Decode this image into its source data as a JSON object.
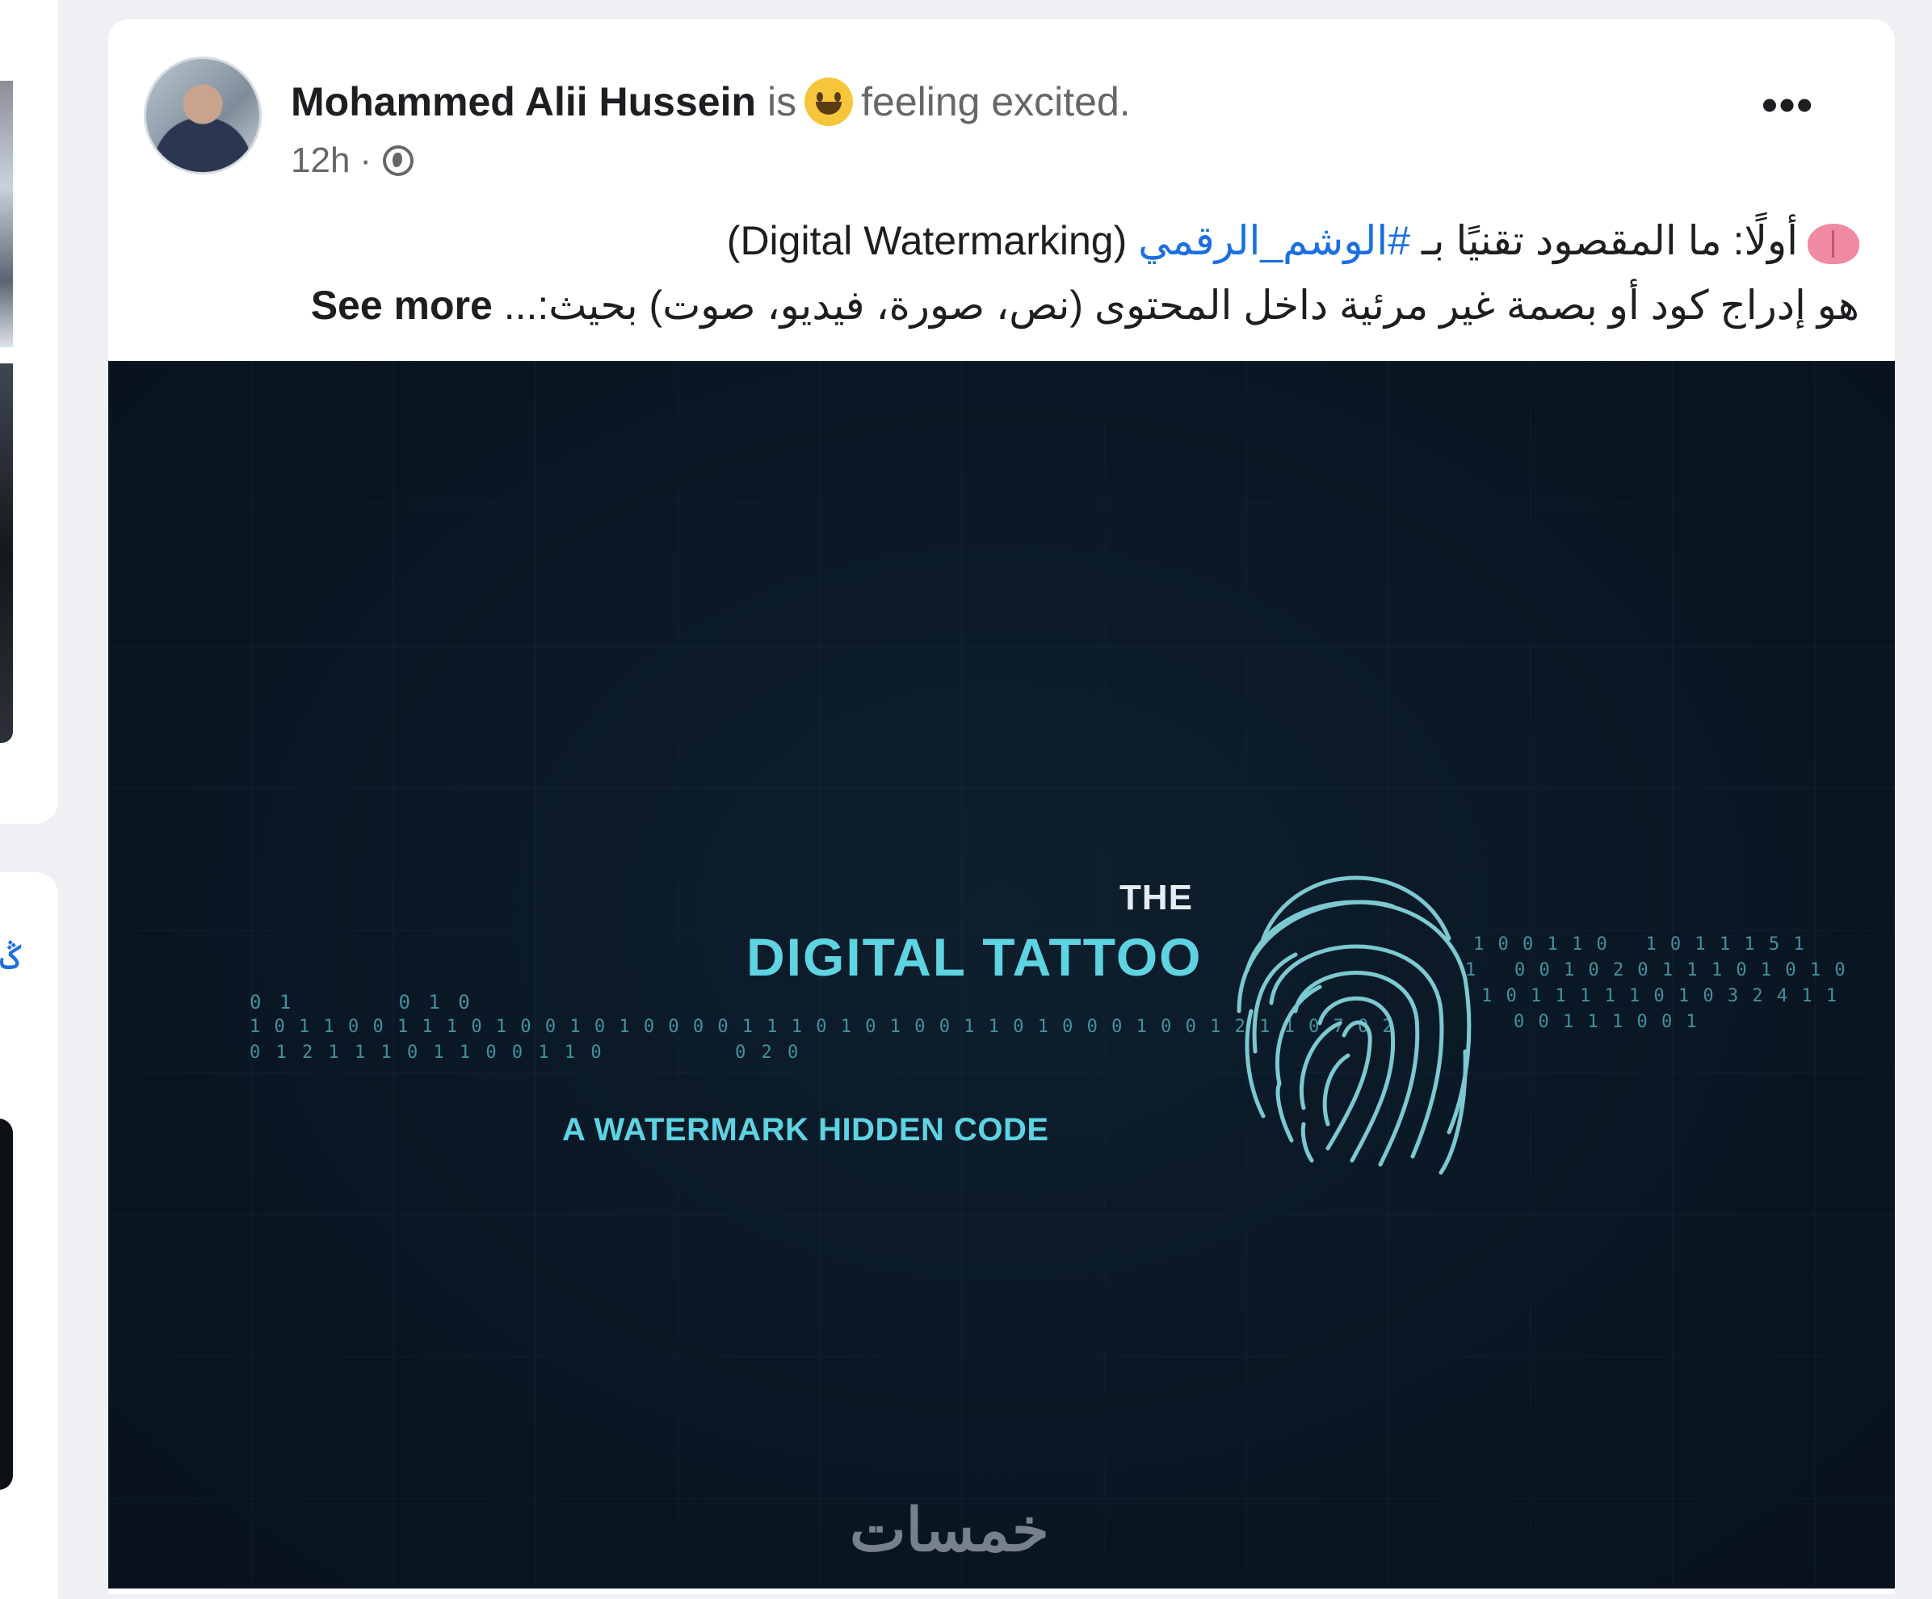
{
  "left_column": {
    "link_glyph": "ݣ"
  },
  "post": {
    "author": "Mohammed Alii Hussein",
    "is_text": "is",
    "feeling_text": "feeling excited.",
    "time": "12h",
    "separator": "·",
    "privacy_icon": "globe-icon",
    "more_icon": "•••",
    "text": {
      "line1_prefix": "أولًا: ما المقصود تقنيًا بـ ",
      "hashtag": "#الوشم_الرقمي",
      "line1_suffix": " (Digital Watermarking)",
      "line2": "هو إدراج كود أو بصمة غير مرئية داخل المحتوى (نص، صورة، فيديو، صوت) بحيث:... ",
      "see_more": "See more"
    },
    "image": {
      "the": "THE",
      "title": "DIGITAL TATTOO",
      "subtitle": "A WATERMARK HIDDEN CODE",
      "binary_left_1": "0 1       0 1 0",
      "binary_left_2": "1 0 1 1 0 0 1 1 1 0 1 0 0 1 0 1 0 0 0 0 1 1 1 0 1 0 1 0 0 1 1 0 1 0 0 0 1 0 0 1 2 1 1 0 7 0 2",
      "binary_left_3": "0 1 2 1 1 1 0 1 1 0 0 1 1 0          0 2 0",
      "binary_right_1": "1 0 0 1 1 0   1 0 1 1 1 5 1",
      "binary_right_2": "1   0 0 1 0 2 0 1 1 1 0 1 0 1 0",
      "binary_right_3": "1 0 1 1 1 1 1 0 1 0 3 2 4 1 1",
      "binary_right_4": "0 0 1 1 1 0 0 1",
      "watermark": "خمسات"
    }
  }
}
